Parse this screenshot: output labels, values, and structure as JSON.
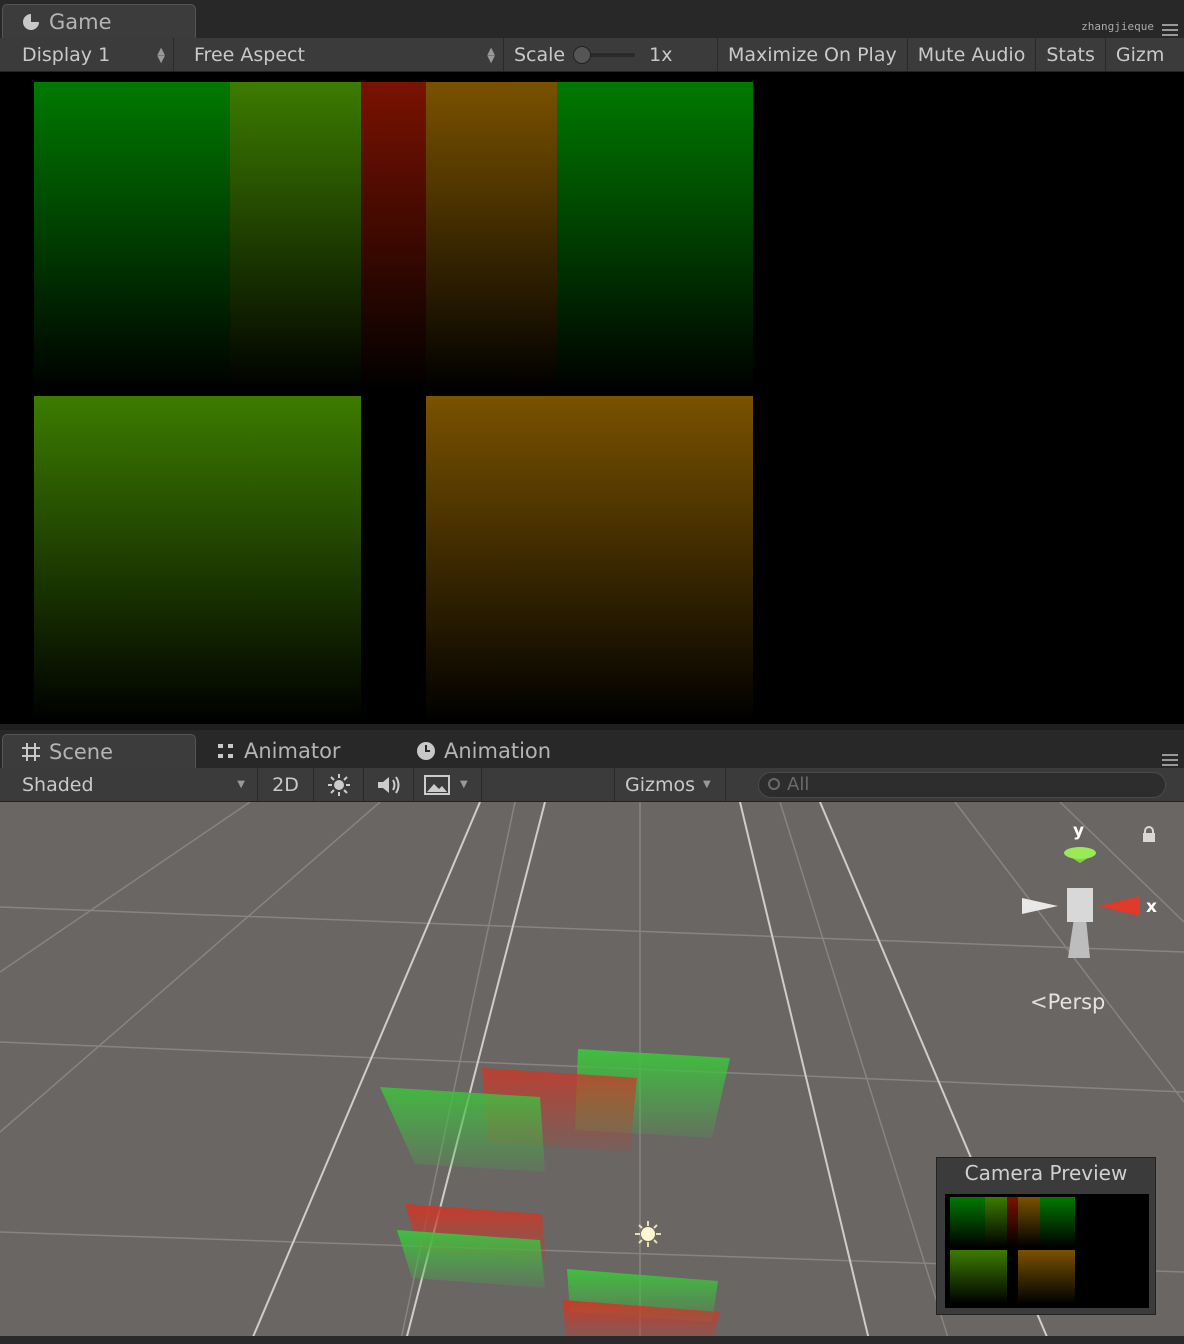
{
  "game": {
    "tab_label": "Game",
    "user": "zhangjieque",
    "toolbar": {
      "display": "Display 1",
      "aspect": "Free Aspect",
      "scale_label": "Scale",
      "scale_value": "1x",
      "maximize": "Maximize On Play",
      "mute": "Mute Audio",
      "stats": "Stats",
      "gizmos": "Gizm"
    },
    "colors": {
      "green": "#007a00",
      "olive": "#3c7c00",
      "red": "#7a1200",
      "orange": "#7a5200"
    }
  },
  "scene": {
    "tabs": [
      {
        "label": "Scene",
        "icon": "grid-icon"
      },
      {
        "label": "Animator",
        "icon": "animator-icon"
      },
      {
        "label": "Animation",
        "icon": "clock-icon"
      }
    ],
    "toolbar": {
      "shading": "Shaded",
      "mode_2d": "2D",
      "gizmos": "Gizmos",
      "search_placeholder": "All"
    },
    "gizmo_axes": {
      "y": "y",
      "x": "x"
    },
    "projection": "Persp",
    "camera_preview_title": "Camera Preview"
  }
}
